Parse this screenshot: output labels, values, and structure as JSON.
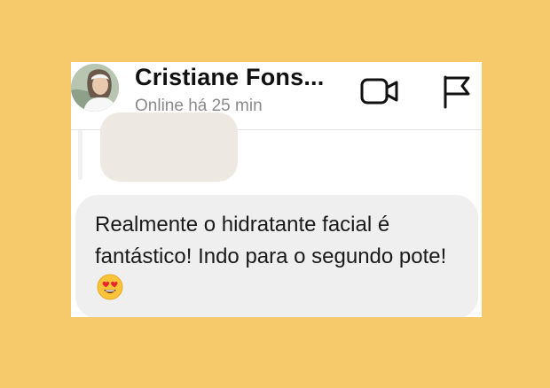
{
  "header": {
    "contact_name": "Cristiane Fons...",
    "status": "Online há 25 min",
    "avatar_icon": "user-avatar-photo",
    "video_call_icon": "video-camera-icon",
    "report_icon": "flag-icon"
  },
  "messages": [
    {
      "text": "Realmente o hidratante facial é fantástico! Indo para o segundo pote!",
      "emoji": "smiling-face-with-heart-eyes"
    }
  ],
  "colors": {
    "background": "#F6C96B",
    "bubble": "#EFEFEF",
    "text": "#1A1A1A",
    "status_text": "#8A8A8A"
  }
}
